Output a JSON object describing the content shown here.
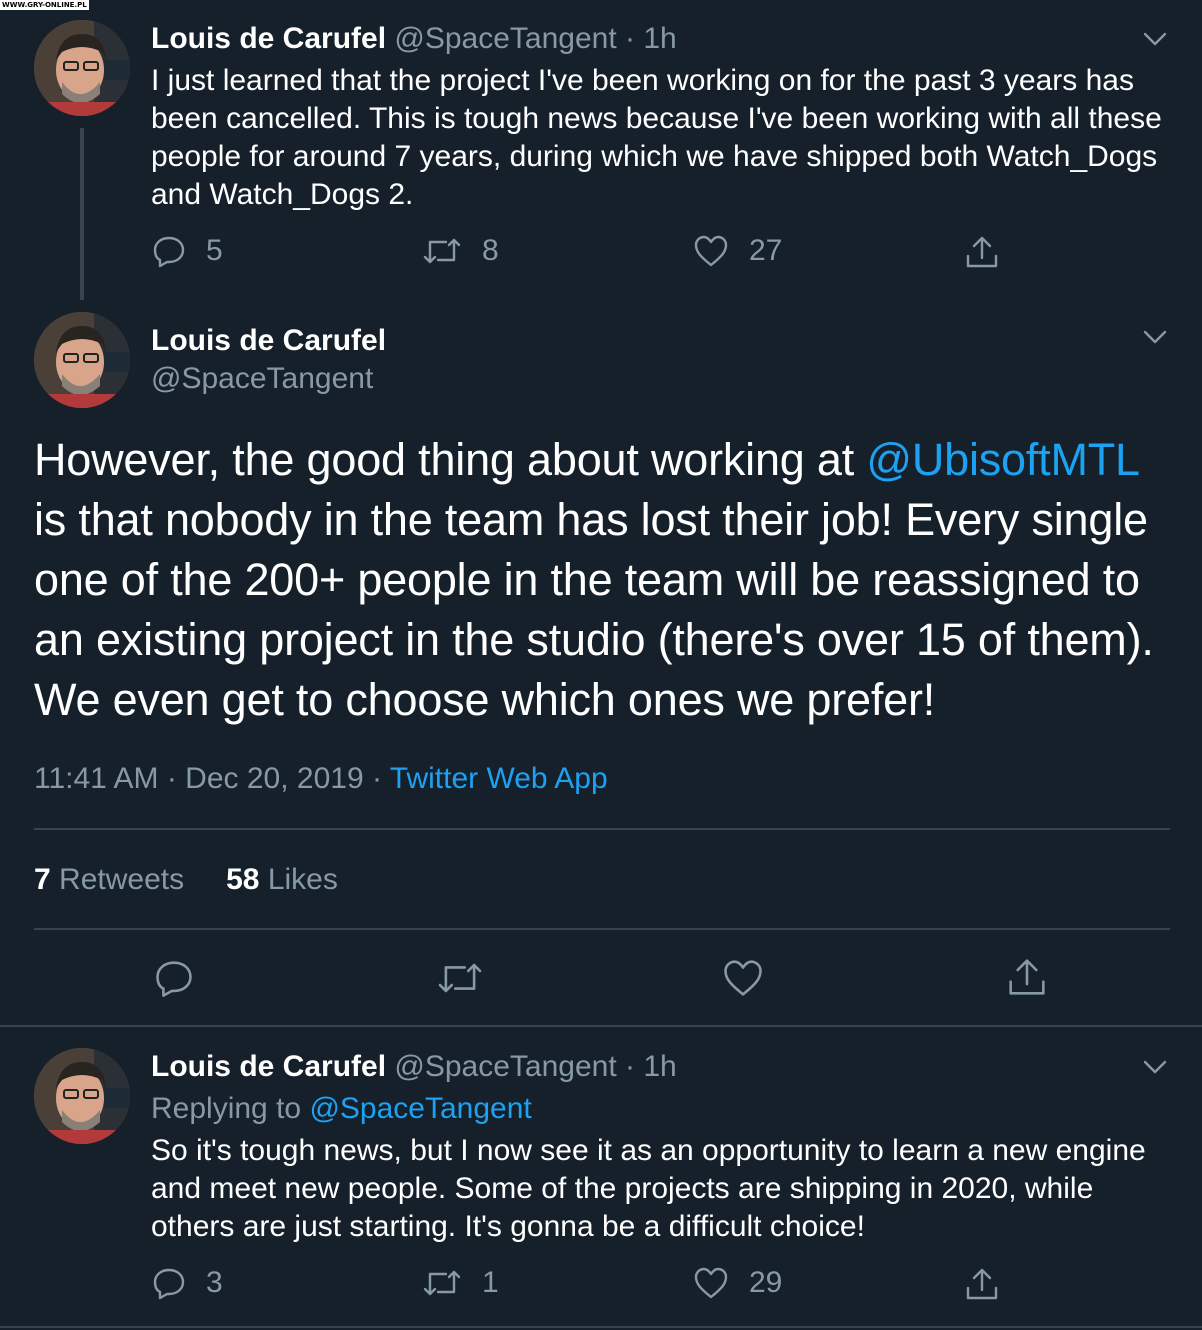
{
  "watermark": "WWW.GRY-ONLINE.PL",
  "colors": {
    "background": "#15202b",
    "muted": "#8899a6",
    "link": "#1da1f2",
    "divider": "#38444d"
  },
  "tweet1": {
    "name": "Louis de Carufel",
    "handle": "@SpaceTangent",
    "dot": "·",
    "time": "1h",
    "text": "I just learned that the project I've been working on for the past 3 years has been cancelled. This is tough news because I've been working with all these people for around 7 years, during which we have shipped both Watch_Dogs and Watch_Dogs 2.",
    "replies": "5",
    "retweets": "8",
    "likes": "27"
  },
  "main_tweet": {
    "name": "Louis de Carufel",
    "handle": "@SpaceTangent",
    "text_before": "However, the good thing about working at ",
    "mention": "@UbisoftMTL",
    "text_after": " is that nobody in the team has lost their job! Every single one of the 200+ people in the team will be reassigned to an existing project in the studio (there's over 15 of them). We even get to choose which ones we prefer!",
    "timestamp": "11:41 AM · Dec 20, 2019 · ",
    "source": "Twitter Web App",
    "retweets_count": "7",
    "retweets_label": "Retweets",
    "likes_count": "58",
    "likes_label": "Likes"
  },
  "tweet3": {
    "name": "Louis de Carufel",
    "handle": "@SpaceTangent",
    "dot": "·",
    "time": "1h",
    "replying_prefix": "Replying to ",
    "replying_to": "@SpaceTangent",
    "text": "So it's tough news, but I now see it as an opportunity to learn a new engine and meet new people. Some of the projects are shipping in 2020, while others are just starting. It's gonna be a difficult choice!",
    "replies": "3",
    "retweets": "1",
    "likes": "29"
  },
  "icons": {
    "reply": "reply-icon",
    "retweet": "retweet-icon",
    "like": "heart-icon",
    "share": "share-icon",
    "more": "chevron-down-icon"
  }
}
